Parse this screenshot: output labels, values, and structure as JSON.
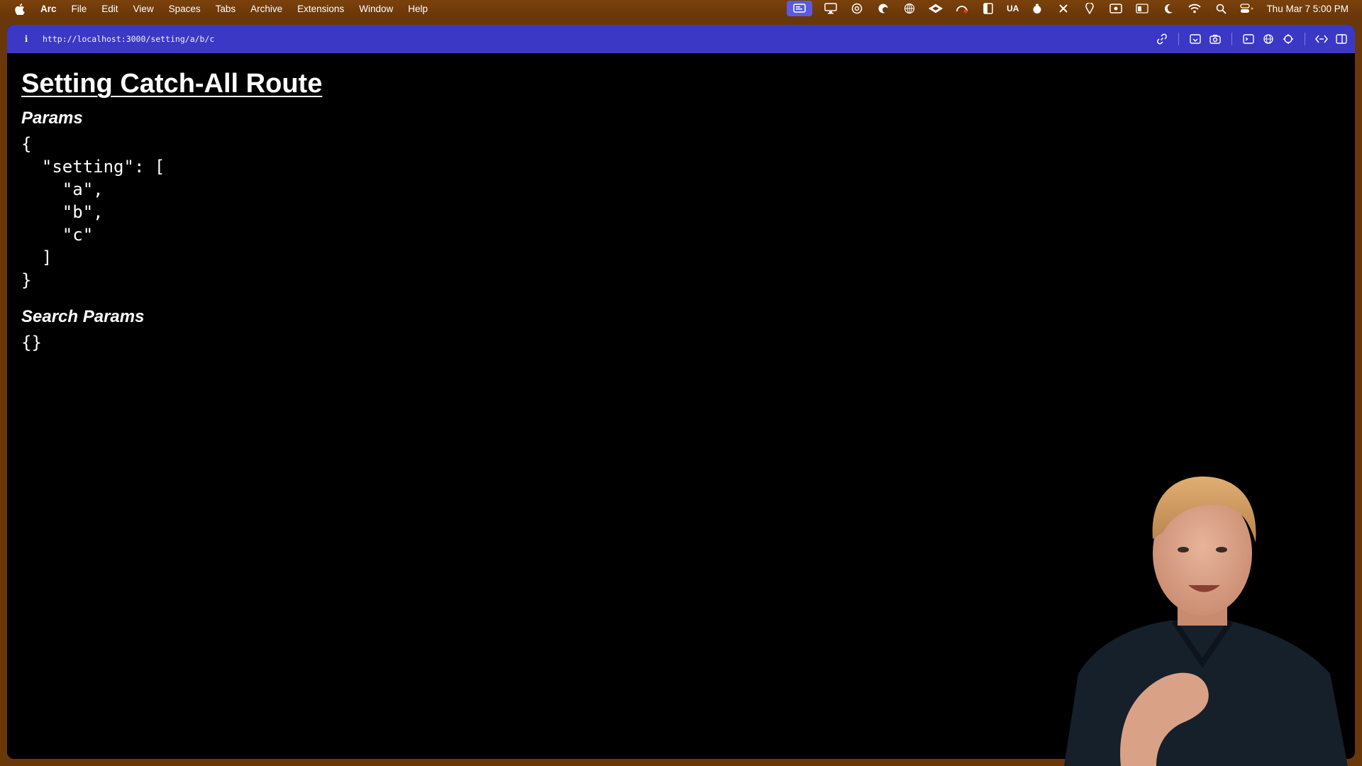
{
  "menubar": {
    "app_name": "Arc",
    "items": [
      "File",
      "Edit",
      "View",
      "Spaces",
      "Tabs",
      "Archive",
      "Extensions",
      "Window",
      "Help"
    ],
    "tray_text": "UA",
    "clock": "Thu Mar 7  5:00 PM"
  },
  "browser": {
    "url": "http://localhost:3000/setting/a/b/c",
    "accent": "#3b38c6"
  },
  "page": {
    "title": "Setting Catch-All Route",
    "params_heading": "Params",
    "params_json": "{\n  \"setting\": [\n    \"a\",\n    \"b\",\n    \"c\"\n  ]\n}",
    "search_heading": "Search Params",
    "search_json": "{}"
  }
}
